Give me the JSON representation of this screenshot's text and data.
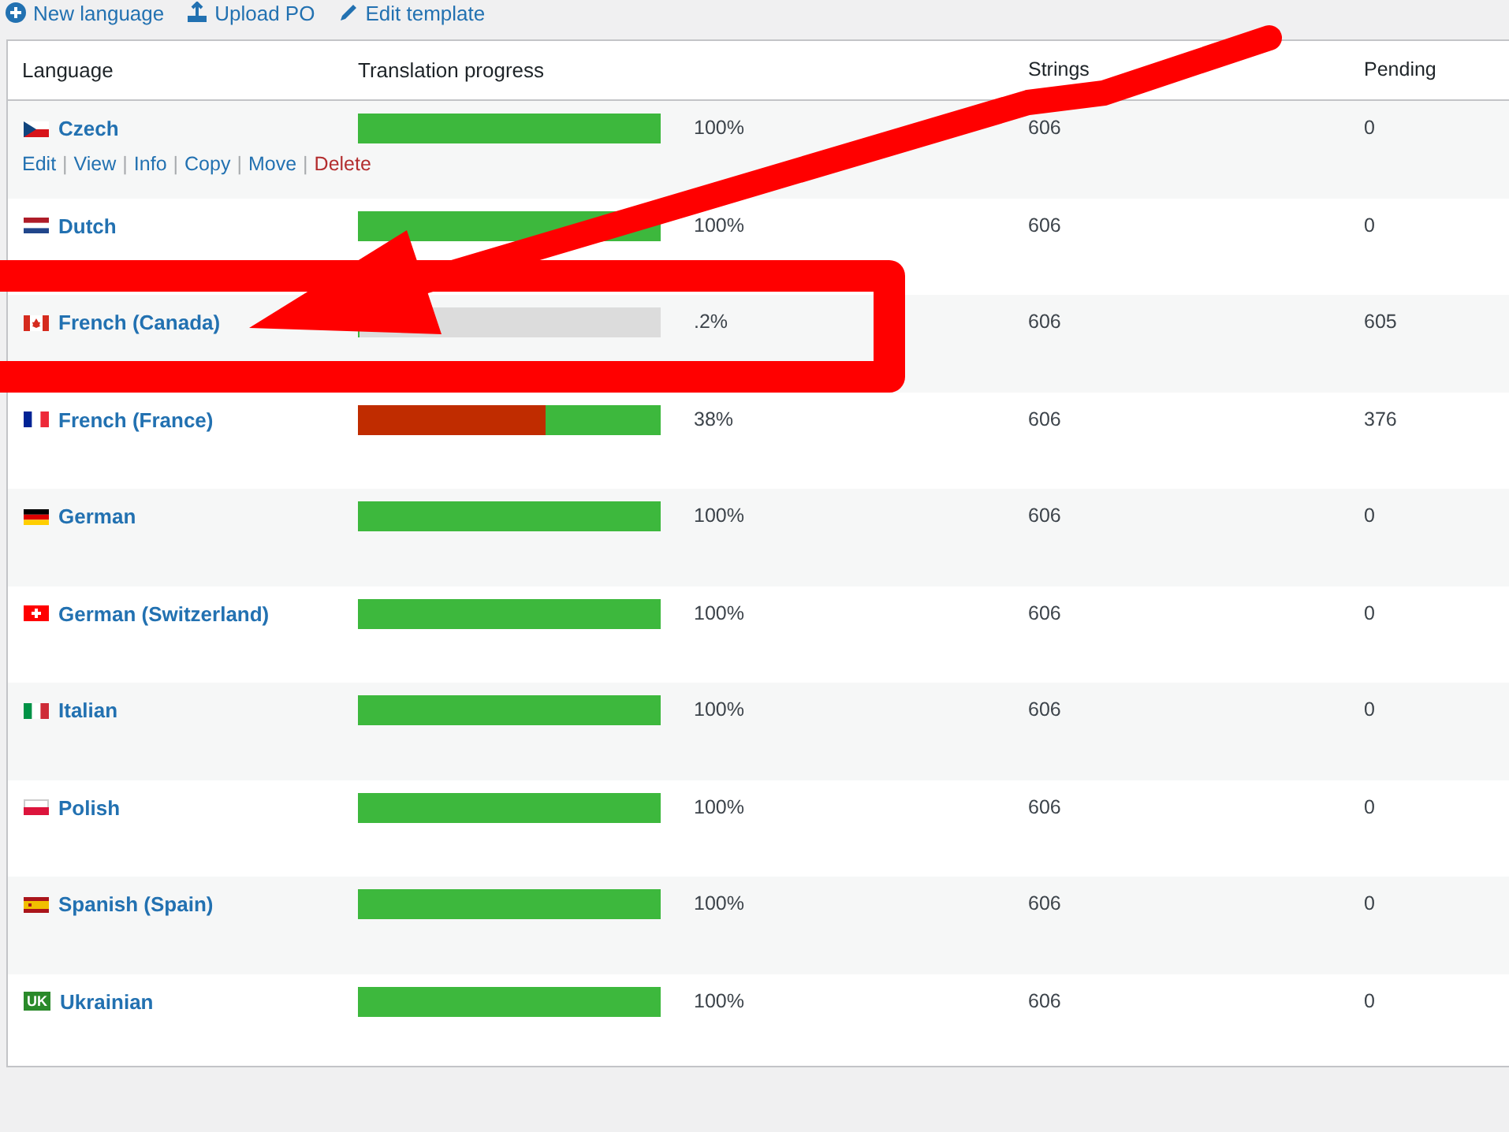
{
  "toolbar": [
    {
      "label": "New language"
    },
    {
      "label": "Upload PO"
    },
    {
      "label": "Edit template"
    }
  ],
  "table": {
    "columns": [
      "Language",
      "Translation progress",
      "Strings",
      "Pending"
    ],
    "rows": [
      {
        "kind": "complete",
        "name": "Czech",
        "level": 1,
        "percent": "100%",
        "strings": "606",
        "pending": "0",
        "action_separator": "|",
        "actions": [
          {
            "label": "Edit",
            "kind": "normal"
          },
          {
            "label": "View",
            "kind": "normal"
          },
          {
            "label": "Info",
            "kind": "normal"
          },
          {
            "label": "Copy",
            "kind": "normal"
          },
          {
            "label": "Move",
            "kind": "normal"
          },
          {
            "label": "Delete",
            "kind": "danger"
          }
        ]
      },
      {
        "kind": "complete",
        "name": "Dutch",
        "level": 1,
        "percent": "100%",
        "strings": "606",
        "pending": "0"
      },
      {
        "kind": "untranslated",
        "name": "French (Canada)",
        "level": 0.002,
        "percent": ".2%",
        "strings": "606",
        "pending": "605"
      },
      {
        "kind": "fuzzy",
        "name": "French (France)",
        "level": 0.38,
        "percent": "38%",
        "strings": "606",
        "pending": "376"
      },
      {
        "kind": "complete",
        "name": "German",
        "level": 1,
        "percent": "100%",
        "strings": "606",
        "pending": "0"
      },
      {
        "kind": "complete",
        "name": "German (Switzerland)",
        "level": 1,
        "percent": "100%",
        "strings": "606",
        "pending": "0"
      },
      {
        "kind": "complete",
        "name": "Italian",
        "level": 1,
        "percent": "100%",
        "strings": "606",
        "pending": "0"
      },
      {
        "kind": "complete",
        "name": "Polish",
        "level": 1,
        "percent": "100%",
        "strings": "606",
        "pending": "0"
      },
      {
        "kind": "complete",
        "name": "Spanish (Spain)",
        "level": 1,
        "percent": "100%",
        "strings": "606",
        "pending": "0"
      },
      {
        "kind": "complete",
        "flag_label": "UK",
        "name": "Ukrainian",
        "level": 1,
        "percent": "100%",
        "strings": "606",
        "pending": "0"
      }
    ]
  },
  "annotation": {
    "arrow": true,
    "frame": true
  }
}
